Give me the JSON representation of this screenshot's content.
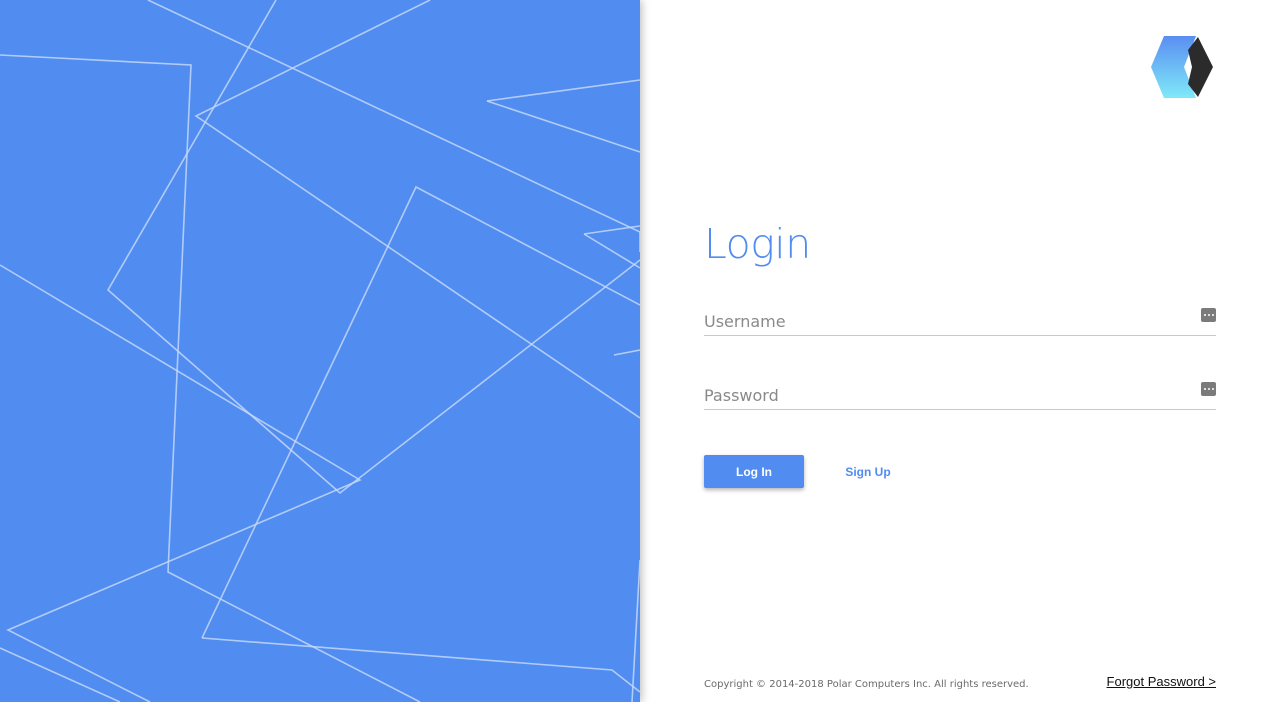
{
  "login": {
    "title": "Login",
    "username_placeholder": "Username",
    "password_placeholder": "Password",
    "login_button": "Log In",
    "signup_button": "Sign Up",
    "forgot_password": "Forgot Password >"
  },
  "footer": {
    "copyright": "Copyright © 2014-2018 Polar Computers Inc. All rights reserved."
  },
  "colors": {
    "accent": "#518cf0",
    "panel_background": "#518cf0",
    "line_color": "#c9dcfa"
  },
  "icons": {
    "logo": "polar-computers-logo",
    "field_icon": "password-manager-key-icon"
  }
}
